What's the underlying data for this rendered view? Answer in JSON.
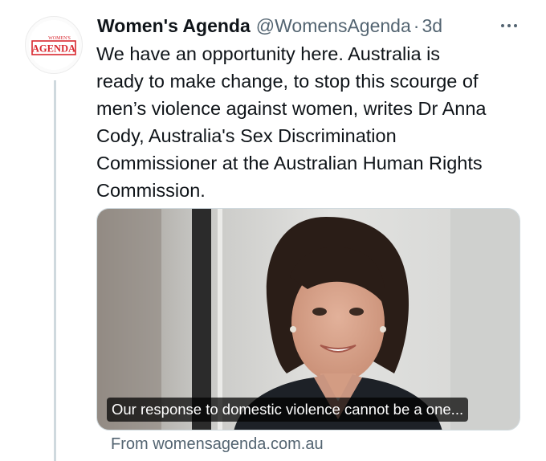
{
  "tweet": {
    "author": {
      "name": "Women's Agenda",
      "handle": "@WomensAgenda",
      "separator": "·",
      "time": "3d",
      "avatar": {
        "icon": "womens-agenda-logo",
        "logo_top_text": "WOMEN'S",
        "logo_text": "AGENDA",
        "brand_color": "#d8272f"
      }
    },
    "more_icon": "more-dots-icon",
    "text_lines": [
      "We have an opportunity here. Australia is",
      "ready to make change, to stop this scourge of",
      "men’s violence against women, writes Dr Anna",
      "Cody, Australia's Sex Discrimination",
      "Commissioner at the Australian Human Rights",
      "Commission."
    ],
    "card": {
      "caption": "Our response to domestic violence cannot be a one...",
      "source": "From womensagenda.com.au"
    },
    "colors": {
      "text": "#0f1419",
      "secondary": "#536471",
      "thread_line": "#cfd9de"
    }
  }
}
